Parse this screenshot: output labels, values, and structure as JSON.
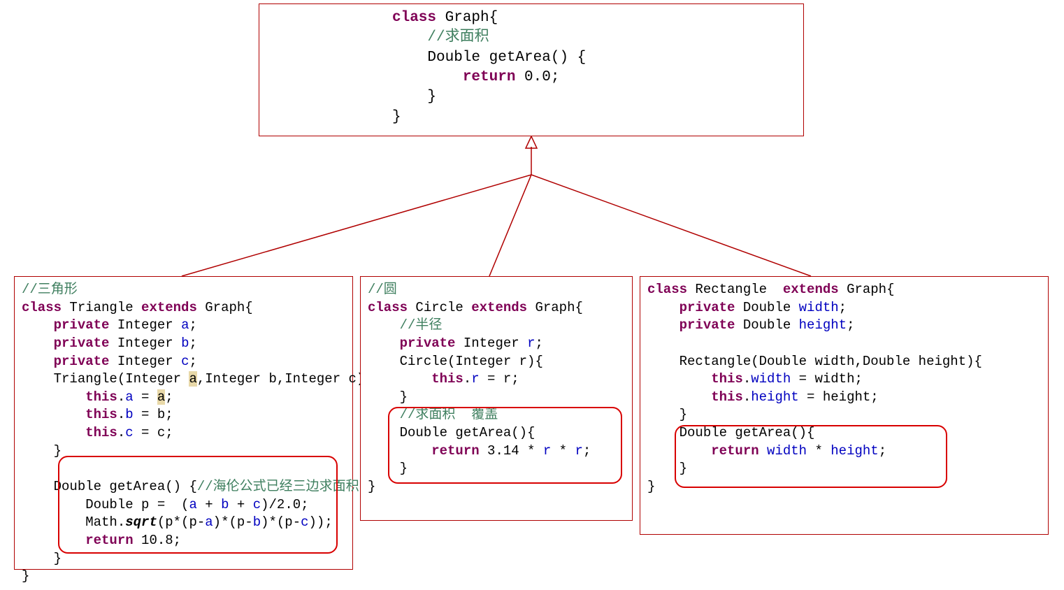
{
  "parent": {
    "tokens": [
      [
        [
          "kw",
          "class"
        ],
        [
          "typ",
          " Graph{"
        ]
      ],
      [
        [
          "com",
          "    //求面积"
        ]
      ],
      [
        [
          "typ",
          "    Double getArea() {"
        ]
      ],
      [
        [
          "typ",
          "        "
        ],
        [
          "kw",
          "return"
        ],
        [
          "typ",
          " 0.0;"
        ]
      ],
      [
        [
          "typ",
          "    }"
        ]
      ],
      [
        [
          "typ",
          "}"
        ]
      ]
    ]
  },
  "children": [
    {
      "id": "triangle",
      "tokens": [
        [
          [
            "com",
            "//三角形"
          ]
        ],
        [
          [
            "kw",
            "class"
          ],
          [
            "typ",
            " Triangle "
          ],
          [
            "kw",
            "extends"
          ],
          [
            "typ",
            " Graph{"
          ]
        ],
        [
          [
            "typ",
            "    "
          ],
          [
            "kw",
            "private"
          ],
          [
            "typ",
            " Integer "
          ],
          [
            "fld",
            "a"
          ],
          [
            "typ",
            ";"
          ]
        ],
        [
          [
            "typ",
            "    "
          ],
          [
            "kw",
            "private"
          ],
          [
            "typ",
            " Integer "
          ],
          [
            "fld",
            "b"
          ],
          [
            "typ",
            ";"
          ]
        ],
        [
          [
            "typ",
            "    "
          ],
          [
            "kw",
            "private"
          ],
          [
            "typ",
            " Integer "
          ],
          [
            "fld",
            "c"
          ],
          [
            "typ",
            ";"
          ]
        ],
        [
          [
            "typ",
            "    Triangle(Integer "
          ],
          [
            "hl",
            "a"
          ],
          [
            "typ",
            ",Integer b,Integer c){"
          ]
        ],
        [
          [
            "typ",
            "        "
          ],
          [
            "kw",
            "this"
          ],
          [
            "typ",
            "."
          ],
          [
            "fld",
            "a"
          ],
          [
            "typ",
            " = "
          ],
          [
            "hl",
            "a"
          ],
          [
            "typ",
            ";"
          ]
        ],
        [
          [
            "typ",
            "        "
          ],
          [
            "kw",
            "this"
          ],
          [
            "typ",
            "."
          ],
          [
            "fld",
            "b"
          ],
          [
            "typ",
            " = b;"
          ]
        ],
        [
          [
            "typ",
            "        "
          ],
          [
            "kw",
            "this"
          ],
          [
            "typ",
            "."
          ],
          [
            "fld",
            "c"
          ],
          [
            "typ",
            " = c;"
          ]
        ],
        [
          [
            "typ",
            "    }"
          ]
        ],
        [
          [
            "typ",
            " "
          ]
        ],
        [
          [
            "typ",
            "    Double getArea() {"
          ],
          [
            "com",
            "//海伦公式已经三边求面积"
          ]
        ],
        [
          [
            "typ",
            "        Double p =  ("
          ],
          [
            "fld",
            "a"
          ],
          [
            "typ",
            " + "
          ],
          [
            "fld",
            "b"
          ],
          [
            "typ",
            " + "
          ],
          [
            "fld",
            "c"
          ],
          [
            "typ",
            ")/2.0;"
          ]
        ],
        [
          [
            "typ",
            "        Math."
          ],
          [
            "ital",
            "sqrt"
          ],
          [
            "typ",
            "(p*(p-"
          ],
          [
            "fld",
            "a"
          ],
          [
            "typ",
            ")*(p-"
          ],
          [
            "fld",
            "b"
          ],
          [
            "typ",
            ")*(p-"
          ],
          [
            "fld",
            "c"
          ],
          [
            "typ",
            "));"
          ]
        ],
        [
          [
            "typ",
            "        "
          ],
          [
            "kw",
            "return"
          ],
          [
            "typ",
            " 10.8;"
          ]
        ],
        [
          [
            "typ",
            "    }"
          ]
        ],
        [
          [
            "typ",
            "}"
          ]
        ]
      ]
    },
    {
      "id": "circle",
      "tokens": [
        [
          [
            "com",
            "//圆"
          ]
        ],
        [
          [
            "kw",
            "class"
          ],
          [
            "typ",
            " Circle "
          ],
          [
            "kw",
            "extends"
          ],
          [
            "typ",
            " Graph{"
          ]
        ],
        [
          [
            "typ",
            "    "
          ],
          [
            "com",
            "//半径"
          ]
        ],
        [
          [
            "typ",
            "    "
          ],
          [
            "kw",
            "private"
          ],
          [
            "typ",
            " Integer "
          ],
          [
            "fld",
            "r"
          ],
          [
            "typ",
            ";"
          ]
        ],
        [
          [
            "typ",
            "    Circle(Integer r){"
          ]
        ],
        [
          [
            "typ",
            "        "
          ],
          [
            "kw",
            "this"
          ],
          [
            "typ",
            "."
          ],
          [
            "fld",
            "r"
          ],
          [
            "typ",
            " = r;"
          ]
        ],
        [
          [
            "typ",
            "    }"
          ]
        ],
        [
          [
            "typ",
            "    "
          ],
          [
            "com",
            "//求面积  覆盖"
          ]
        ],
        [
          [
            "typ",
            "    Double getArea(){"
          ]
        ],
        [
          [
            "typ",
            "        "
          ],
          [
            "kw",
            "return"
          ],
          [
            "typ",
            " 3.14 * "
          ],
          [
            "fld",
            "r"
          ],
          [
            "typ",
            " * "
          ],
          [
            "fld",
            "r"
          ],
          [
            "typ",
            ";"
          ]
        ],
        [
          [
            "typ",
            "    }"
          ]
        ],
        [
          [
            "typ",
            "}"
          ]
        ]
      ]
    },
    {
      "id": "rectangle",
      "tokens": [
        [
          [
            "kw",
            "class"
          ],
          [
            "typ",
            " Rectangle  "
          ],
          [
            "kw",
            "extends"
          ],
          [
            "typ",
            " Graph{"
          ]
        ],
        [
          [
            "typ",
            "    "
          ],
          [
            "kw",
            "private"
          ],
          [
            "typ",
            " Double "
          ],
          [
            "fld",
            "width"
          ],
          [
            "typ",
            ";"
          ]
        ],
        [
          [
            "typ",
            "    "
          ],
          [
            "kw",
            "private"
          ],
          [
            "typ",
            " Double "
          ],
          [
            "fld",
            "height"
          ],
          [
            "typ",
            ";"
          ]
        ],
        [
          [
            "typ",
            " "
          ]
        ],
        [
          [
            "typ",
            "    Rectangle(Double width,Double height){"
          ]
        ],
        [
          [
            "typ",
            "        "
          ],
          [
            "kw",
            "this"
          ],
          [
            "typ",
            "."
          ],
          [
            "fld",
            "width"
          ],
          [
            "typ",
            " = width;"
          ]
        ],
        [
          [
            "typ",
            "        "
          ],
          [
            "kw",
            "this"
          ],
          [
            "typ",
            "."
          ],
          [
            "fld",
            "height"
          ],
          [
            "typ",
            " = height;"
          ]
        ],
        [
          [
            "typ",
            "    }"
          ]
        ],
        [
          [
            "typ",
            "    Double getArea(){"
          ]
        ],
        [
          [
            "typ",
            "        "
          ],
          [
            "kw",
            "return"
          ],
          [
            "typ",
            " "
          ],
          [
            "fld",
            "width"
          ],
          [
            "typ",
            " * "
          ],
          [
            "fld",
            "height"
          ],
          [
            "typ",
            ";"
          ]
        ],
        [
          [
            "typ",
            "    }"
          ]
        ],
        [
          [
            "typ",
            "}"
          ]
        ]
      ]
    }
  ]
}
